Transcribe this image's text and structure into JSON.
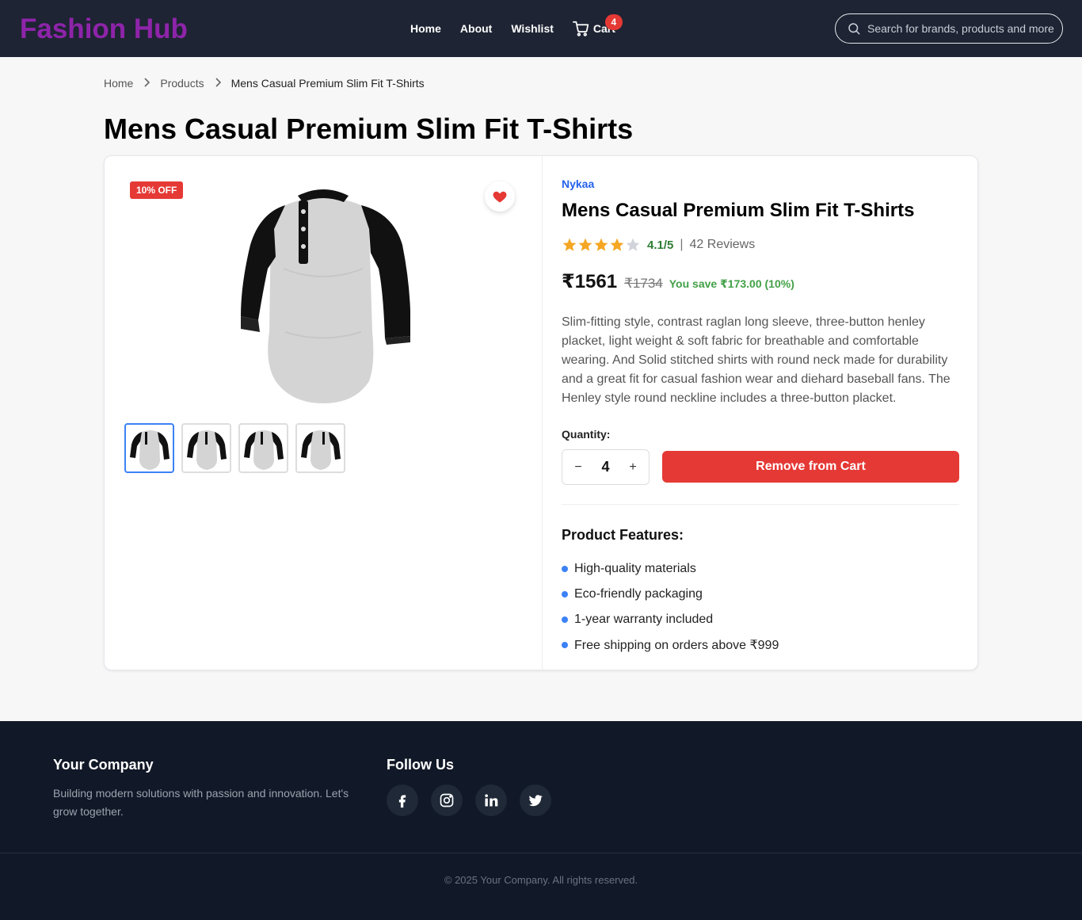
{
  "navbar": {
    "brand": "Fashion Hub",
    "links": [
      "Home",
      "About",
      "Wishlist"
    ],
    "cart_label": "Cart",
    "cart_count": "4",
    "search_placeholder": "Search for brands, products and more"
  },
  "breadcrumb": {
    "items": [
      "Home",
      "Products",
      "Mens Casual Premium Slim Fit T-Shirts"
    ]
  },
  "page_title": "Mens Casual Premium Slim Fit T-Shirts",
  "product": {
    "discount_badge": "10% OFF",
    "brand": "Nykaa",
    "name": "Mens Casual Premium Slim Fit T-Shirts",
    "rating_value": 4.1,
    "rating_text": "4.1/5",
    "rating_separator": "|",
    "reviews": "42 Reviews",
    "price": "₹1561",
    "mrp": "₹1734",
    "savings": "You save ₹173.00 (10%)",
    "description": "Slim-fitting style, contrast raglan long sleeve, three-button henley placket, light weight & soft fabric for breathable and comfortable wearing. And Solid stitched shirts with round neck made for durability and a great fit for casual fashion wear and diehard baseball fans. The Henley style round neckline includes a three-button placket.",
    "quantity_label": "Quantity:",
    "quantity": "4",
    "decrement_symbol": "−",
    "increment_symbol": "+",
    "remove_button": "Remove from Cart",
    "features_title": "Product Features:",
    "features": [
      "High-quality materials",
      "Eco-friendly packaging",
      "1-year warranty included",
      "Free shipping on orders above ₹999"
    ]
  },
  "footer": {
    "company": "Your Company",
    "description": "Building modern solutions with passion and innovation. Let's grow together.",
    "follow_title": "Follow Us",
    "socials": [
      "facebook-icon",
      "instagram-icon",
      "linkedin-icon",
      "twitter-icon"
    ],
    "copyright": "© 2025 Your Company. All rights reserved."
  },
  "colors": {
    "navbar_bg": "#1e2433",
    "brand": "#8e24aa",
    "accent_red": "#e53935",
    "link_blue": "#2563eb",
    "rating_green": "#2e7d32",
    "star_gold": "#f5a623",
    "footer_bg": "#111827"
  }
}
